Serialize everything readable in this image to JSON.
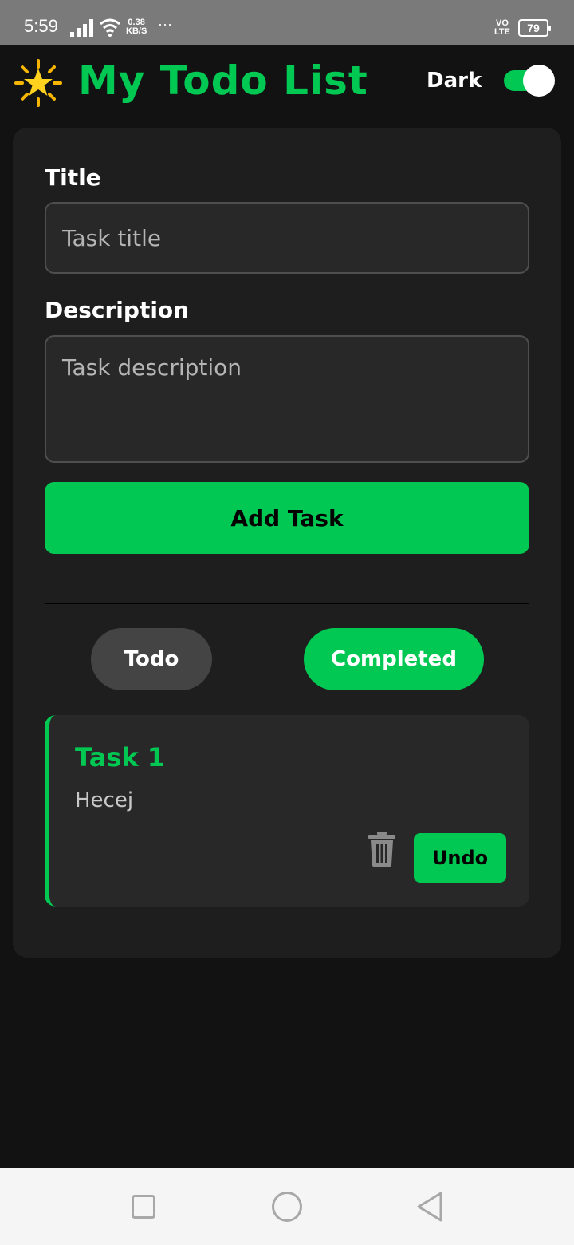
{
  "status_bar": {
    "time": "5:59",
    "speed_value": "0.38",
    "speed_unit": "KB/S",
    "dots": "···",
    "lte_top": "VO",
    "lte_bottom": "LTE",
    "battery": "79"
  },
  "header": {
    "icon": "star-icon",
    "title": "My Todo List",
    "theme_label": "Dark",
    "theme_toggle_on": true
  },
  "form": {
    "title_label": "Title",
    "title_placeholder": "Task title",
    "description_label": "Description",
    "description_placeholder": "Task description",
    "add_button_label": "Add Task"
  },
  "filters": {
    "todo_label": "Todo",
    "completed_label": "Completed",
    "active": "completed"
  },
  "tasks": [
    {
      "title": "Task 1",
      "description": "Hecej",
      "action_label": "Undo"
    }
  ],
  "colors": {
    "accent": "#00c853",
    "background": "#121212",
    "card": "#1e1e1e",
    "input": "#282828"
  }
}
